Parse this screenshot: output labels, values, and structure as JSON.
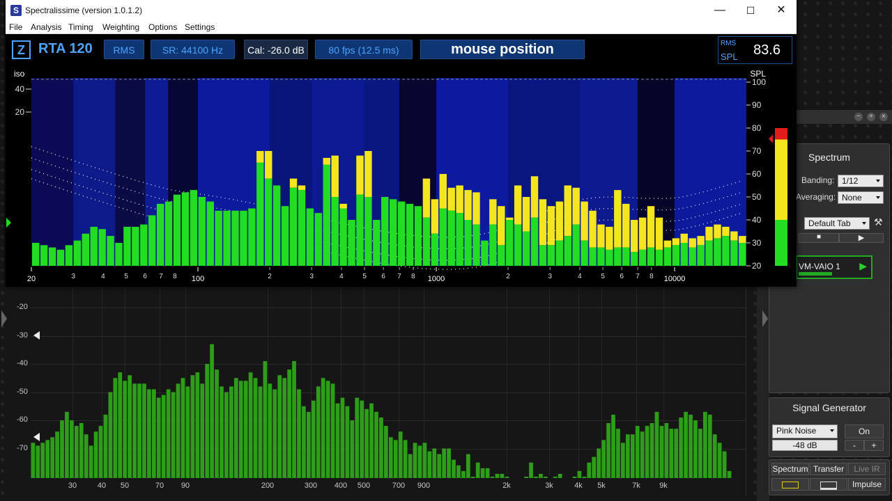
{
  "window": {
    "title": "Spectralissime (version 1.0.1.2)",
    "controls": {
      "minimize": "—",
      "maximize": "☐",
      "close": "✕"
    }
  },
  "menu": [
    "File",
    "Analysis",
    "Timing",
    "Weighting",
    "Options",
    "Settings"
  ],
  "infobar": {
    "z_label": "Z",
    "rta_label": "RTA 120",
    "mode": "RMS",
    "sample_rate": "SR: 44100 Hz",
    "cal": "Cal:  -26.0 dB",
    "fps": "80 fps (12.5 ms)",
    "mouse": "mouse position",
    "spl_rms_label": "RMS",
    "spl_label": "SPL",
    "spl_value": "83.6"
  },
  "rta": {
    "left_axis_label": "iso",
    "right_axis_label": "SPL",
    "left_ticks": [
      40,
      20
    ],
    "right_ticks": [
      100,
      90,
      80,
      70,
      60,
      50,
      40,
      30,
      20
    ],
    "x_major": [
      {
        "f": 20,
        "label": "20"
      },
      {
        "f": 100,
        "label": "100"
      },
      {
        "f": 1000,
        "label": "1000"
      },
      {
        "f": 10000,
        "label": "10000"
      }
    ],
    "x_minor": [
      "2",
      "3",
      "4",
      "5",
      "6",
      "7",
      "8"
    ],
    "colors": {
      "green": "#22dd22",
      "yellow": "#f5e51c",
      "bg": "#06063a",
      "blue": "#0a1a9a"
    },
    "level_meter": {
      "green_top": 40,
      "yellow_top": 75,
      "red_top": 80
    },
    "current": [
      30,
      29,
      28,
      27,
      29,
      31,
      34,
      37,
      36,
      33,
      30,
      37,
      37,
      38,
      42,
      47,
      48,
      51,
      52,
      53,
      50,
      48,
      44,
      44,
      44,
      44,
      45,
      65,
      58,
      55,
      46,
      54,
      53,
      45,
      43,
      64,
      50,
      45,
      40,
      51,
      50,
      40,
      50,
      49,
      48,
      47,
      46,
      41,
      34,
      45,
      44,
      43,
      40,
      38,
      31,
      38,
      29,
      40,
      38,
      35,
      41,
      29,
      29,
      31,
      33,
      38,
      31,
      28,
      28,
      27,
      28,
      28,
      26,
      27,
      28,
      27,
      28,
      29,
      30,
      28,
      29,
      31,
      32,
      33,
      31,
      30
    ],
    "peak": [
      30,
      29,
      28,
      27,
      29,
      31,
      34,
      37,
      36,
      33,
      30,
      37,
      37,
      38,
      42,
      47,
      48,
      51,
      52,
      53,
      50,
      48,
      44,
      44,
      44,
      44,
      45,
      70,
      70,
      55,
      46,
      58,
      55,
      45,
      43,
      67,
      68,
      47,
      40,
      68,
      70,
      40,
      50,
      49,
      48,
      47,
      46,
      58,
      49,
      60,
      54,
      55,
      53,
      52,
      31,
      49,
      46,
      41,
      55,
      50,
      59,
      49,
      46,
      48,
      55,
      54,
      48,
      44,
      38,
      37,
      53,
      47,
      40,
      41,
      46,
      41,
      31,
      32,
      34,
      32,
      33,
      37,
      38,
      37,
      35,
      33
    ]
  },
  "bg_app": {
    "y_ticks": [
      "-20",
      "-30",
      "-40",
      "-50",
      "-60",
      "-70"
    ],
    "x_ticks": [
      "30",
      "40",
      "50",
      "70",
      "90",
      "200",
      "300",
      "400",
      "500",
      "700",
      "900",
      "2k",
      "3k",
      "4k",
      "5k",
      "7k",
      "9k"
    ],
    "bars": [
      -68,
      -69,
      -68,
      -67,
      -66,
      -64,
      -60,
      -57,
      -60,
      -62,
      -61,
      -65,
      -69,
      -64,
      -62,
      -58,
      -50,
      -45,
      -43,
      -46,
      -44,
      -47,
      -47,
      -47,
      -49,
      -49,
      -52,
      -51,
      -49,
      -50,
      -47,
      -45,
      -48,
      -44,
      -43,
      -47,
      -40,
      -33,
      -42,
      -48,
      -50,
      -48,
      -45,
      -46,
      -46,
      -43,
      -45,
      -48,
      -39,
      -47,
      -49,
      -44,
      -45,
      -42,
      -39,
      -49,
      -55,
      -57,
      -53,
      -48,
      -45,
      -46,
      -47,
      -54,
      -52,
      -55,
      -60,
      -52,
      -53,
      -56,
      -54,
      -57,
      -59,
      -62,
      -66,
      -67,
      -64,
      -67,
      -72,
      -68,
      -69,
      -68,
      -71,
      -70,
      -72,
      -70,
      -70,
      -74,
      -76,
      -78,
      -72,
      -80,
      -75,
      -77,
      -77,
      -80,
      -79,
      -79,
      -80,
      -82,
      -86,
      -88,
      -80,
      -75,
      -80,
      -79,
      -80,
      -81,
      -80,
      -79,
      -83,
      -86,
      -80,
      -78,
      -80,
      -75,
      -73,
      -70,
      -67,
      -61,
      -58,
      -63,
      -68,
      -65,
      -65,
      -62,
      -64,
      -62,
      -61,
      -57,
      -62,
      -61,
      -63,
      -63,
      -59,
      -57,
      -58,
      -60,
      -63,
      -57,
      -58,
      -65,
      -68,
      -71,
      -78,
      -82,
      -86
    ],
    "bar_color": "#2e9e1a",
    "spectrum_panel": {
      "title": "Spectrum",
      "banding_label": "Banding:",
      "banding_value": "1/12",
      "averaging_label": "Averaging:",
      "averaging_value": "None",
      "tab_value": "Default Tab",
      "device": "VM-VAIO 1"
    },
    "signal_panel": {
      "title": "Signal Generator",
      "noise": "Pink Noise",
      "on": "On",
      "level": "-48 dB",
      "minus": "-",
      "plus": "+"
    },
    "mode_tabs": [
      "Spectrum",
      "Transfer",
      "Live IR"
    ],
    "impulse": "Impulse"
  }
}
